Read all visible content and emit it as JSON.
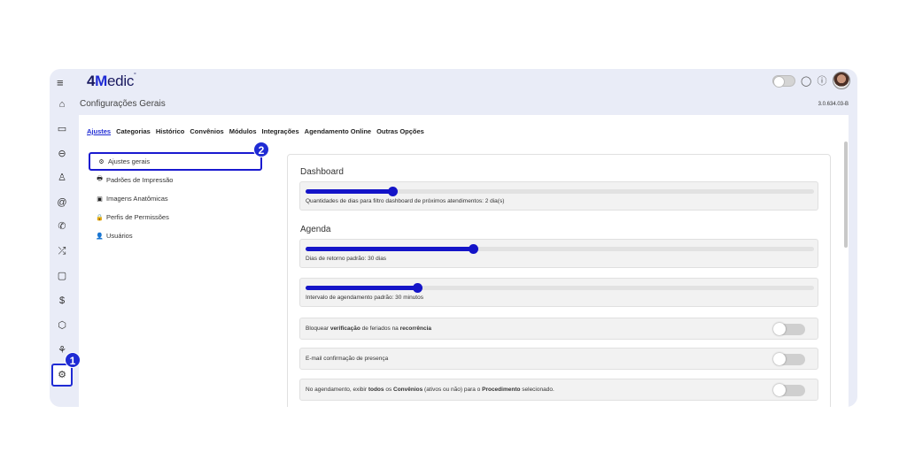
{
  "app": {
    "logo_main": "4",
    "logo_m": "M",
    "logo_rest": "edic",
    "logo_mark": "°"
  },
  "header": {
    "page_title": "Configurações Gerais",
    "version": "3.0.634.03-B"
  },
  "tabs": [
    {
      "label": "Ajustes",
      "active": true
    },
    {
      "label": "Categorias"
    },
    {
      "label": "Histórico"
    },
    {
      "label": "Convênios"
    },
    {
      "label": "Módulos"
    },
    {
      "label": "Integrações"
    },
    {
      "label": "Agendamento Online"
    },
    {
      "label": "Outras Opções"
    }
  ],
  "menu": [
    {
      "icon": "⚙",
      "label": "Ajustes gerais",
      "selected": true
    },
    {
      "icon": "🖶",
      "label": "Padrões de Impressão"
    },
    {
      "icon": "▣",
      "label": "Imagens Anatômicas"
    },
    {
      "icon": "🔒",
      "label": "Perfis de Permissões"
    },
    {
      "icon": "👤",
      "label": "Usuários"
    }
  ],
  "sections": {
    "dashboard": "Dashboard",
    "agenda": "Agenda"
  },
  "sliders": {
    "dashboard_days": {
      "label": "Quantidades de dias para filtro dashboard de próximos atendimentos: 2 dia(s)",
      "value": 0.17
    },
    "return_days": {
      "label": "Dias de retorno padrão: 30 dias",
      "value": 0.33
    },
    "interval": {
      "label": "Intervalo de agendamento padrão: 30 minutos",
      "value": 0.22
    }
  },
  "toggles": {
    "holiday": {
      "pre": "Bloquear ",
      "b1": "verificação",
      "mid": " de feriados na ",
      "b2": "recorrência",
      "post": ""
    },
    "email": {
      "text": "E-mail confirmação de presença"
    },
    "convenios": {
      "pre": "No agendamento, exibir ",
      "b1": "todos",
      "mid1": " os ",
      "b2": "Convênios",
      "mid2": " (ativos ou não) para o ",
      "b3": "Procedimento",
      "post": " selecionado."
    }
  },
  "badges": {
    "one": "1",
    "two": "2"
  },
  "colors": {
    "accent": "#1f2bd4",
    "slider": "#1414c8",
    "app_bg": "#e9ecf7"
  },
  "sidebar_icons": [
    "menu-icon",
    "home-icon",
    "calendar-icon",
    "car-icon",
    "user-icon",
    "at-icon",
    "phone-icon",
    "shuffle-icon",
    "clipboard-icon",
    "dollar-icon",
    "cube-icon",
    "plant-icon",
    "gear-icon"
  ]
}
